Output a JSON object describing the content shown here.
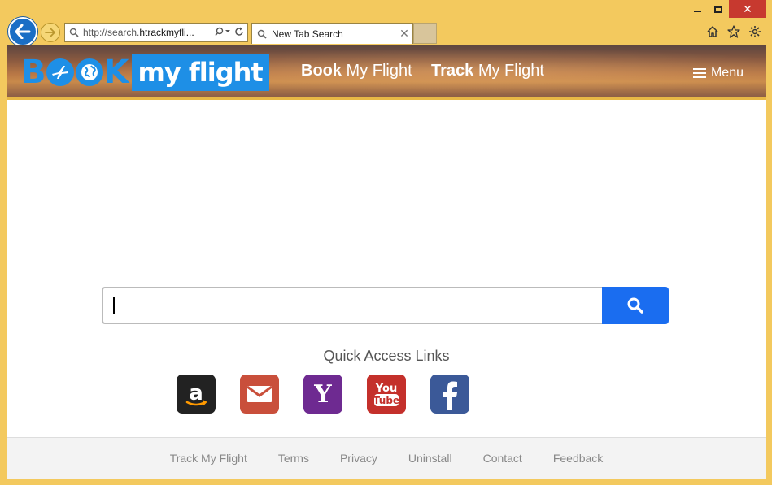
{
  "browser": {
    "address_prefix": "http://search.",
    "address_highlight": "htrackmyfli...",
    "tab_title": "New Tab Search",
    "tab_close": "✕",
    "window_buttons": {
      "minimize": "",
      "maximize": "",
      "close": "✕"
    },
    "toolbar_icons": [
      "home-icon",
      "star-icon",
      "gear-icon"
    ]
  },
  "header": {
    "logo_book": [
      "B",
      "K"
    ],
    "logo_flight": "my flight",
    "nav": [
      {
        "bold": "Book",
        "rest": " My Flight"
      },
      {
        "bold": "Track",
        "rest": " My Flight"
      }
    ],
    "menu_label": "Menu"
  },
  "search": {
    "value": "",
    "placeholder": "",
    "button_icon": "search-icon",
    "accent_color": "#1a6df0"
  },
  "quick_access": {
    "title": "Quick Access Links",
    "links": [
      "Amazon",
      "Gmail",
      "Yahoo",
      "YouTube",
      "Facebook"
    ]
  },
  "footer": {
    "links": [
      "Track My Flight",
      "Terms",
      "Privacy",
      "Uninstall",
      "Contact",
      "Feedback"
    ]
  },
  "colors": {
    "frame": "#f3c95e",
    "brand_blue": "#1e8fe6"
  }
}
